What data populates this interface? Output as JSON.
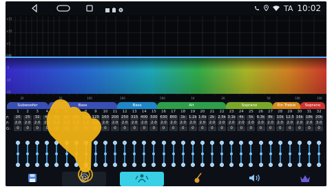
{
  "status": {
    "carrier": "TA",
    "time": "10:02",
    "nav": [
      "back-icon",
      "home-icon",
      "recents-icon"
    ],
    "notification_icons": [
      "gallery-icon",
      "download-icon",
      "settings-icon"
    ],
    "right_icons": [
      "phone-icon",
      "location-icon",
      "wifi-icon"
    ]
  },
  "graph": {
    "y_ticks": [
      "+15",
      "+10",
      "+5",
      "0dB",
      "-5",
      "-10",
      "-15"
    ],
    "x_ticks": [
      "20",
      "50",
      "100",
      "200",
      "500",
      "1K",
      "2K",
      "5K",
      "10K",
      "20K"
    ],
    "curve_level_db": 0
  },
  "bands": [
    {
      "label": "Subwoofer",
      "color": "#3a4fb5"
    },
    {
      "label": "Bass",
      "color": "#3a4fb5"
    },
    {
      "label": "Bass",
      "color": "#1f86c8"
    },
    {
      "label": "Alt",
      "color": "#2e9e4a"
    },
    {
      "label": "Soprano",
      "color": "#7aa72a"
    },
    {
      "label": "Ein Treble",
      "color": "#d88a1e"
    },
    {
      "label": "Soprano",
      "color": "#d0342f"
    }
  ],
  "table": {
    "row_labels": [
      "F:",
      "F:",
      "Q:",
      "G:"
    ],
    "band_numbers": [
      "1",
      "2",
      "3",
      "4",
      "5",
      "6",
      "7",
      "8",
      "9",
      "10",
      "11",
      "12",
      "13",
      "14",
      "15",
      "16",
      "17",
      "18",
      "19",
      "20",
      "21",
      "22",
      "23",
      "24",
      "25",
      "26",
      "27",
      "28",
      "29",
      "30",
      "31",
      "32"
    ],
    "frequencies": [
      "20",
      "25",
      "32",
      "40",
      "50",
      "63",
      "80",
      "100",
      "125",
      "160",
      "200",
      "250",
      "315",
      "400",
      "500",
      "630",
      "800",
      "1k",
      "1.2k",
      "1.6k",
      "2k",
      "2.5k",
      "3.1k",
      "4k",
      "5k",
      "6.3k",
      "8k",
      "10k",
      "12.5",
      "16k",
      "18k",
      "20k"
    ],
    "q_values": [
      "2.0",
      "2.0",
      "2.0",
      "2.0",
      "2.0",
      "2.0",
      "2.0",
      "2.0",
      "2.0",
      "2.0",
      "2.0",
      "2.0",
      "2.0",
      "2.0",
      "2.0",
      "2.0",
      "2.0",
      "2.0",
      "2.0",
      "2.0",
      "2.0",
      "2.0",
      "2.0",
      "2.0",
      "2.0",
      "2.0",
      "2.0",
      "2.0",
      "2.0",
      "2.0",
      "2.0",
      "3.0"
    ],
    "gains": [
      "0",
      "0",
      "0",
      "0",
      "0",
      "0",
      "0",
      "0",
      "0",
      "0",
      "0",
      "0",
      "0",
      "0",
      "0",
      "0",
      "0",
      "0",
      "0",
      "0",
      "0",
      "0",
      "0",
      "0",
      "0",
      "0",
      "0",
      "0",
      "0",
      "0",
      "0",
      "0"
    ],
    "visible_frequencies_partial": [
      "20",
      "25",
      "32",
      "40"
    ]
  },
  "sliders": {
    "count": 32,
    "level_fraction": 0.5
  },
  "toolbar": {
    "items": [
      {
        "name": "save-icon",
        "active": false
      },
      {
        "name": "reset-icon",
        "active": false
      },
      {
        "name": "equalizer-person-icon",
        "active": true
      },
      {
        "name": "instrument-icon",
        "active": false
      },
      {
        "name": "speaker-icon",
        "active": false
      },
      {
        "name": "crown-icon",
        "active": false
      }
    ],
    "active_color": "#39d0e6"
  }
}
